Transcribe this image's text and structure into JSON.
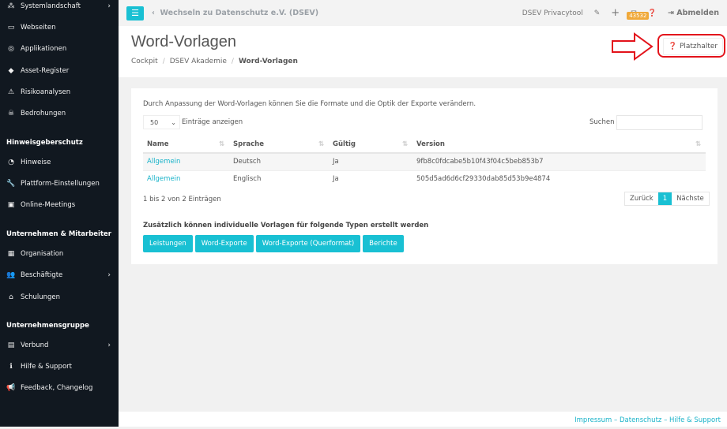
{
  "sidebar": {
    "items": [
      {
        "label": "Systemlandschaft",
        "icon": "network-icon",
        "chev": true
      },
      {
        "label": "Webseiten",
        "icon": "monitor-icon"
      },
      {
        "label": "Applikationen",
        "icon": "disc-icon"
      },
      {
        "label": "Asset-Register",
        "icon": "diamond-icon"
      },
      {
        "label": "Risikoanalysen",
        "icon": "warning-icon"
      },
      {
        "label": "Bedrohungen",
        "icon": "skull-icon"
      },
      {
        "label": "Hinweise",
        "icon": "whistle-icon"
      },
      {
        "label": "Plattform-Einstellungen",
        "icon": "wrench-icon"
      },
      {
        "label": "Online-Meetings",
        "icon": "video-icon"
      },
      {
        "label": "Organisation",
        "icon": "building-icon"
      },
      {
        "label": "Beschäftigte",
        "icon": "users-icon",
        "chev": true
      },
      {
        "label": "Schulungen",
        "icon": "school-icon"
      },
      {
        "label": "Verbund",
        "icon": "chart-icon",
        "chev": true
      },
      {
        "label": "Hilfe & Support",
        "icon": "info-icon"
      },
      {
        "label": "Feedback, Changelog",
        "icon": "megaphone-icon"
      }
    ],
    "headings": [
      "Hinweisgeberschutz",
      "Unternehmen & Mitarbeiter",
      "Unternehmensgruppe"
    ]
  },
  "topbar": {
    "back": "Wechseln zu Datenschutz e.V. (DSEV)",
    "app": "DSEV Privacytool",
    "badge": "43532",
    "logout": "Abmelden"
  },
  "header": {
    "title": "Word-Vorlagen",
    "breadcrumb": [
      "Cockpit",
      "DSEV Akademie",
      "Word-Vorlagen"
    ],
    "placeholder_button": "Platzhalter"
  },
  "main": {
    "intro": "Durch Anpassung der Word-Vorlagen können Sie die Formate und die Optik der Exporte verändern.",
    "page_size": "50",
    "page_size_label": "Einträge anzeigen",
    "search_label": "Suchen",
    "search_value": "",
    "columns": [
      "Name",
      "Sprache",
      "Gültig",
      "Version"
    ],
    "rows": [
      [
        "Allgemein",
        "Deutsch",
        "Ja",
        "9fb8c0fdcabe5b10f43f04c5beb853b7"
      ],
      [
        "Allgemein",
        "Englisch",
        "Ja",
        "505d5ad6d6cf29330dab85d53b9e4874"
      ]
    ],
    "info": "1 bis 2 von 2 Einträgen",
    "prev": "Zurück",
    "page": "1",
    "next": "Nächste",
    "types_label": "Zusätzlich können individuelle Vorlagen für folgende Typen erstellt werden",
    "types": [
      "Leistungen",
      "Word-Exporte",
      "Word-Exporte (Querformat)",
      "Berichte"
    ]
  },
  "footer": "Impressum – Datenschutz – Hilfe & Support",
  "colors": {
    "accent": "#19c0d3",
    "sidebar": "#111820",
    "annotation": "#e3131b"
  }
}
